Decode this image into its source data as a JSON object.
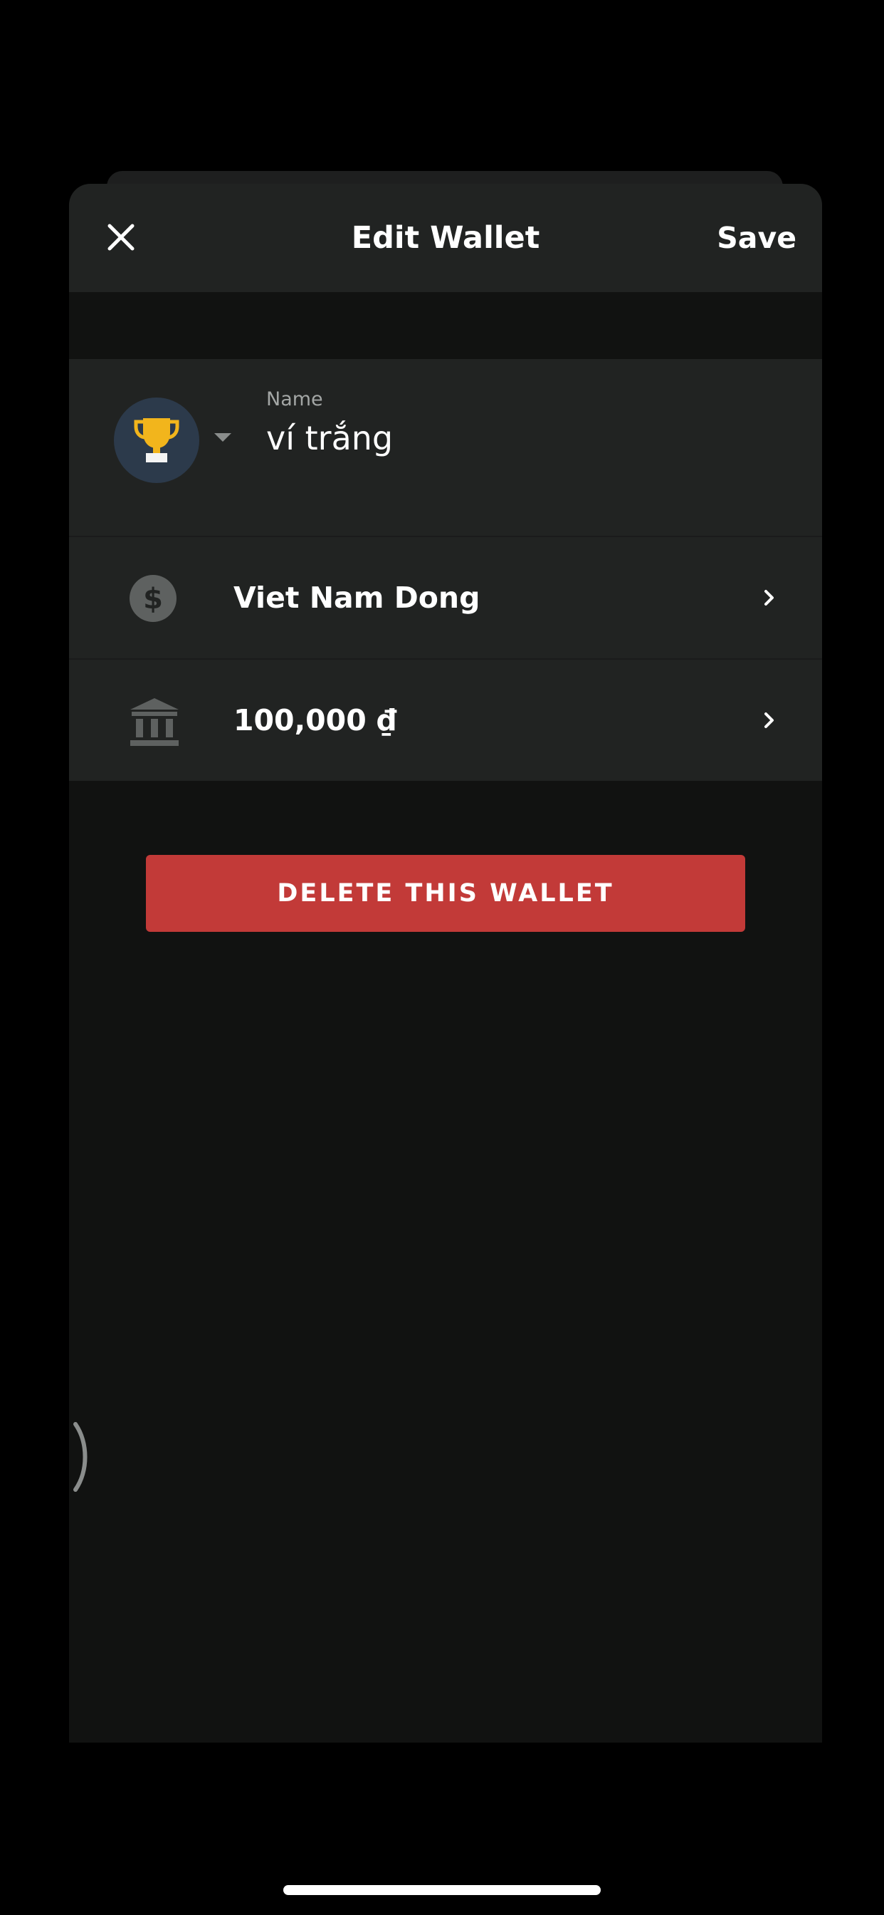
{
  "header": {
    "title": "Edit Wallet",
    "save_label": "Save",
    "close_icon": "close-icon"
  },
  "name_field": {
    "label": "Name",
    "value": "ví trắng",
    "avatar_icon": "trophy-icon",
    "dropdown_icon": "caret-down-icon"
  },
  "rows": [
    {
      "icon": "dollar-circle-icon",
      "label": "Viet Nam Dong"
    },
    {
      "icon": "bank-icon",
      "label": "100,000 ₫"
    }
  ],
  "delete_label": "DELETE THIS WALLET",
  "colors": {
    "background": "#000000",
    "sheet": "#111211",
    "card": "#212322",
    "danger": "#c23a38",
    "avatar_bg": "#2c3a4b",
    "trophy": "#f2b51c"
  }
}
